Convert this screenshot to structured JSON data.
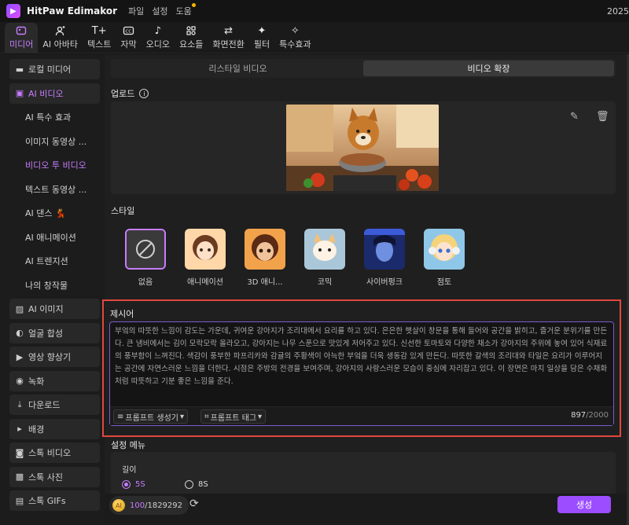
{
  "app": {
    "name": "HitPaw Edimakor",
    "menus": [
      "파일",
      "설정",
      "도움"
    ],
    "year_fragment": "2025"
  },
  "toolbar": [
    {
      "label": "미디어",
      "icon": "media-icon"
    },
    {
      "label": "AI 아바타",
      "icon": "avatar-icon"
    },
    {
      "label": "텍스트",
      "icon": "text-icon"
    },
    {
      "label": "자막",
      "icon": "caption-icon"
    },
    {
      "label": "오디오",
      "icon": "audio-icon"
    },
    {
      "label": "요소들",
      "icon": "elements-icon"
    },
    {
      "label": "화면전환",
      "icon": "transition-icon"
    },
    {
      "label": "필터",
      "icon": "filter-icon"
    },
    {
      "label": "특수효과",
      "icon": "effects-icon"
    }
  ],
  "sidebar": [
    {
      "label": "로컬 미디어",
      "type": "top",
      "icon": "folder-icon"
    },
    {
      "label": "AI 비디오",
      "type": "top",
      "icon": "ai-video-icon",
      "active": true
    },
    {
      "label": "AI 특수 효과",
      "type": "sub"
    },
    {
      "label": "이미지 동영상 ...",
      "type": "sub"
    },
    {
      "label": "비디오 투 비디오",
      "type": "sub",
      "active": true
    },
    {
      "label": "텍스트 동영상 ...",
      "type": "sub"
    },
    {
      "label": "AI 댄스 💃",
      "type": "sub"
    },
    {
      "label": "AI 애니메이션",
      "type": "sub"
    },
    {
      "label": "AI 트렌지션",
      "type": "sub"
    },
    {
      "label": "나의 창작물",
      "type": "sub"
    },
    {
      "label": "AI 이미지",
      "type": "top",
      "icon": "ai-image-icon"
    },
    {
      "label": "얼굴 합성",
      "type": "top",
      "icon": "face-swap-icon"
    },
    {
      "label": "영상 향상기",
      "type": "top",
      "icon": "enhancer-icon"
    },
    {
      "label": "녹화",
      "type": "top",
      "icon": "record-icon"
    },
    {
      "label": "다운로드",
      "type": "top",
      "icon": "download-icon"
    },
    {
      "label": "배경",
      "type": "top",
      "icon": "background-icon"
    },
    {
      "label": "스톡 비디오",
      "type": "top",
      "icon": "stock-video-icon"
    },
    {
      "label": "스톡 사진",
      "type": "top",
      "icon": "stock-photo-icon"
    },
    {
      "label": "스톡 GIFs",
      "type": "top",
      "icon": "gif-icon"
    }
  ],
  "tabs": {
    "restyle": "리스타일 비디오",
    "extend": "비디오 확장"
  },
  "upload": {
    "title": "업로드"
  },
  "style": {
    "title": "스타일",
    "options": [
      "없음",
      "애니메이션",
      "3D 애니...",
      "코믹",
      "사이버펑크",
      "점토"
    ]
  },
  "prompt": {
    "title": "제시어",
    "text": "부엌의 따뜻한 느낌이 감도는 가운데, 귀여운 강아지가 조리대에서 요리를 하고 있다. 은은한 햇살이 창문을 통해 들어와 공간을 밝히고, 즐거운 분위기를 만든다. 큰 냄비에서는 김이 모락모락 올라오고, 강아지는 나무 스푼으로 맛있게 저어주고 있다. 신선한 토마토와 다양한 채소가 강아지의 주위에 놓여 있어 식재료의 풍부함이 느껴진다. 색감이 풍부한 파프리카와 감귤의 주황색이 아늑한 부엌을 더욱 생동감 있게 만든다. 따뜻한 갈색의 조리대와 타일은 요리가 이루어지는 공간에 자연스러운 느낌을 더한다. 시점은 주방의 전경을 보여주며, 강아지의 사랑스러운 모습이 중심에 자리잡고 있다. 이 장면은 마치 일상을 담은 수채화처럼 따뜻하고 기분 좋은 느낌을 준다.",
    "generator_label": "프롬프트 생성기",
    "tag_label": "프롬프트 태그",
    "count_current": "897",
    "count_max": "/2000"
  },
  "settings": {
    "title": "설정 메뉴",
    "length_label": "길이",
    "options": [
      "5S",
      "8S"
    ],
    "selected": "5S"
  },
  "footer": {
    "credits_used": "100",
    "credits_total": "/1829292",
    "generate_label": "생성"
  }
}
